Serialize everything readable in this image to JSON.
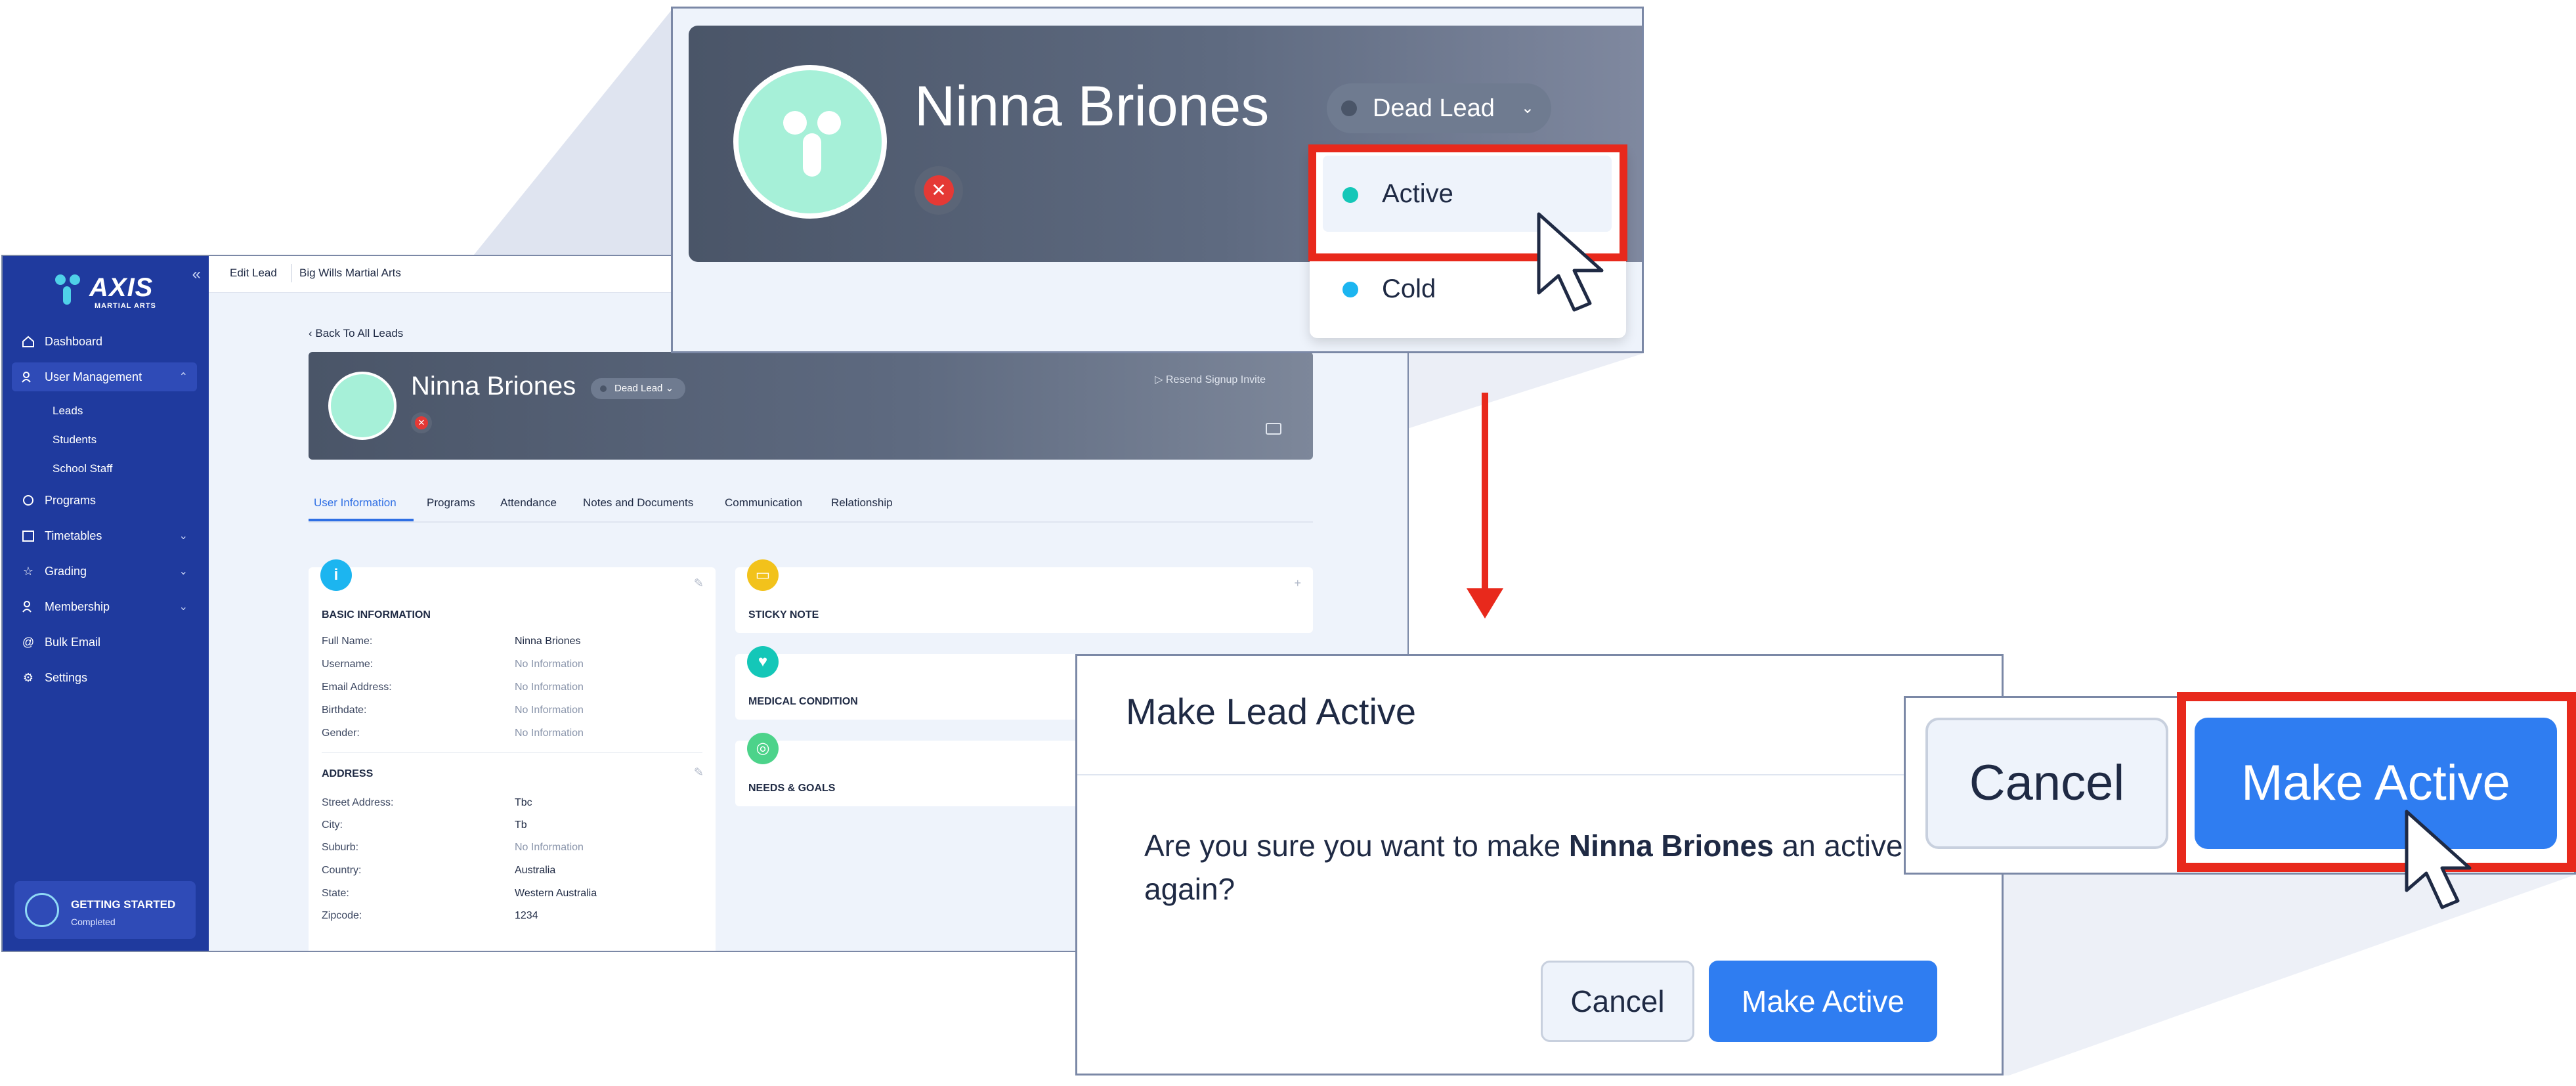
{
  "app": {
    "logo": {
      "text": "AXIS",
      "subtext": "MARTIAL ARTS"
    },
    "breadcrumb": [
      "Edit Lead",
      "Big Wills Martial Arts"
    ],
    "sidebar": {
      "items": [
        {
          "label": "Dashboard",
          "icon": "home-icon"
        },
        {
          "label": "User Management",
          "icon": "users-icon",
          "expanded": true
        },
        {
          "label": "Programs",
          "icon": "programs-icon"
        },
        {
          "label": "Timetables",
          "icon": "calendar-icon"
        },
        {
          "label": "Grading",
          "icon": "star-icon"
        },
        {
          "label": "Membership",
          "icon": "membership-icon"
        },
        {
          "label": "Bulk Email",
          "icon": "at-icon"
        },
        {
          "label": "Settings",
          "icon": "gear-icon"
        }
      ],
      "sub_items": [
        "Leads",
        "Students",
        "School Staff"
      ],
      "getting_started": {
        "title": "GETTING STARTED",
        "status": "Completed"
      }
    },
    "back_link": "Back To All Leads",
    "profile": {
      "name": "Ninna Briones",
      "status": "Dead Lead",
      "resend": "Resend Signup Invite"
    },
    "tabs": [
      "User Information",
      "Programs",
      "Attendance",
      "Notes and Documents",
      "Communication",
      "Relationship"
    ],
    "basic_info": {
      "title": "BASIC INFORMATION",
      "rows": [
        {
          "label": "Full Name:",
          "value": "Ninna Briones"
        },
        {
          "label": "Username:",
          "value": "No Information"
        },
        {
          "label": "Email Address:",
          "value": "No Information"
        },
        {
          "label": "Birthdate:",
          "value": "No Information"
        },
        {
          "label": "Gender:",
          "value": "No Information"
        }
      ]
    },
    "address": {
      "title": "ADDRESS",
      "rows": [
        {
          "label": "Street Address:",
          "value": "Tbc"
        },
        {
          "label": "City:",
          "value": "Tb"
        },
        {
          "label": "Suburb:",
          "value": "No Information"
        },
        {
          "label": "Country:",
          "value": "Australia"
        },
        {
          "label": "State:",
          "value": "Western Australia"
        },
        {
          "label": "Zipcode:",
          "value": "1234"
        }
      ]
    },
    "side_cards": [
      "STICKY NOTE",
      "MEDICAL CONDITION",
      "NEEDS & GOALS"
    ]
  },
  "zoom_dropdown": {
    "name": "Ninna Briones",
    "status": "Dead Lead",
    "options": [
      {
        "label": "Active",
        "color": "#14c7b8"
      },
      {
        "label": "Cold",
        "color": "#1cb5f0"
      }
    ]
  },
  "modal": {
    "title": "Make Lead Active",
    "body_pre": "Are you sure you want to make ",
    "body_name": "Ninna Briones",
    "body_post": " an active lead again?",
    "cancel": "Cancel",
    "confirm": "Make Active"
  },
  "zoom_buttons": {
    "cancel": "Cancel",
    "confirm": "Make Active"
  },
  "colors": {
    "accent": "#2f7df1",
    "sidebar": "#1f3a9e",
    "highlight": "#e8291c"
  }
}
